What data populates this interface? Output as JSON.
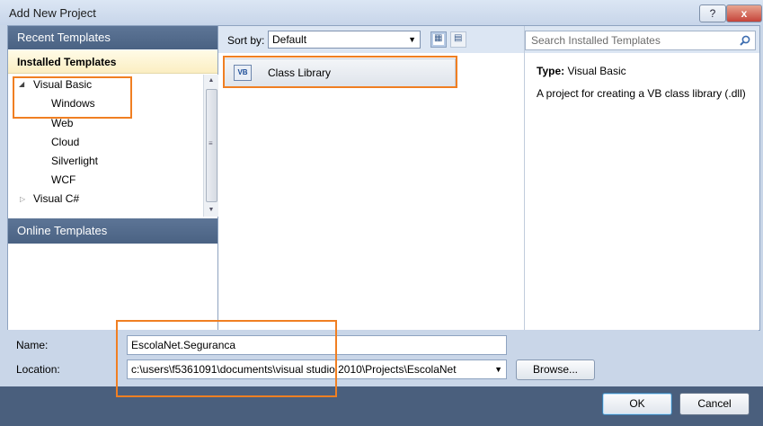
{
  "window": {
    "title": "Add New Project",
    "help_label": "?",
    "close_label": "x"
  },
  "left_panel": {
    "recent_templates": "Recent Templates",
    "installed_templates": "Installed Templates",
    "tree": [
      {
        "label": "Visual Basic",
        "expanded": true
      },
      {
        "label": "Windows",
        "selected": true
      },
      {
        "label": "Web"
      },
      {
        "label": "Cloud"
      },
      {
        "label": "Silverlight"
      },
      {
        "label": "WCF"
      },
      {
        "label": "Visual C#",
        "expanded": false
      }
    ],
    "online_templates": "Online Templates"
  },
  "toolbar": {
    "sort_label": "Sort by:",
    "sort_value": "Default"
  },
  "templates": [
    {
      "name": "Class Library",
      "icon": "vb-class-library-icon"
    }
  ],
  "search": {
    "placeholder": "Search Installed Templates"
  },
  "details": {
    "type_label": "Type:",
    "type_value": "Visual Basic",
    "description": "A project for creating a VB class library (.dll)"
  },
  "form": {
    "name_label": "Name:",
    "name_value": "EscolaNet.Seguranca",
    "location_label": "Location:",
    "location_value": "c:\\users\\f5361091\\documents\\visual studio 2010\\Projects\\EscolaNet",
    "browse_label": "Browse..."
  },
  "buttons": {
    "ok": "OK",
    "cancel": "Cancel"
  },
  "colors": {
    "accent_header": "#4a6283",
    "installed_header": "#fbeec2",
    "footer": "#4a5f7d",
    "highlight": "#f07f22"
  }
}
